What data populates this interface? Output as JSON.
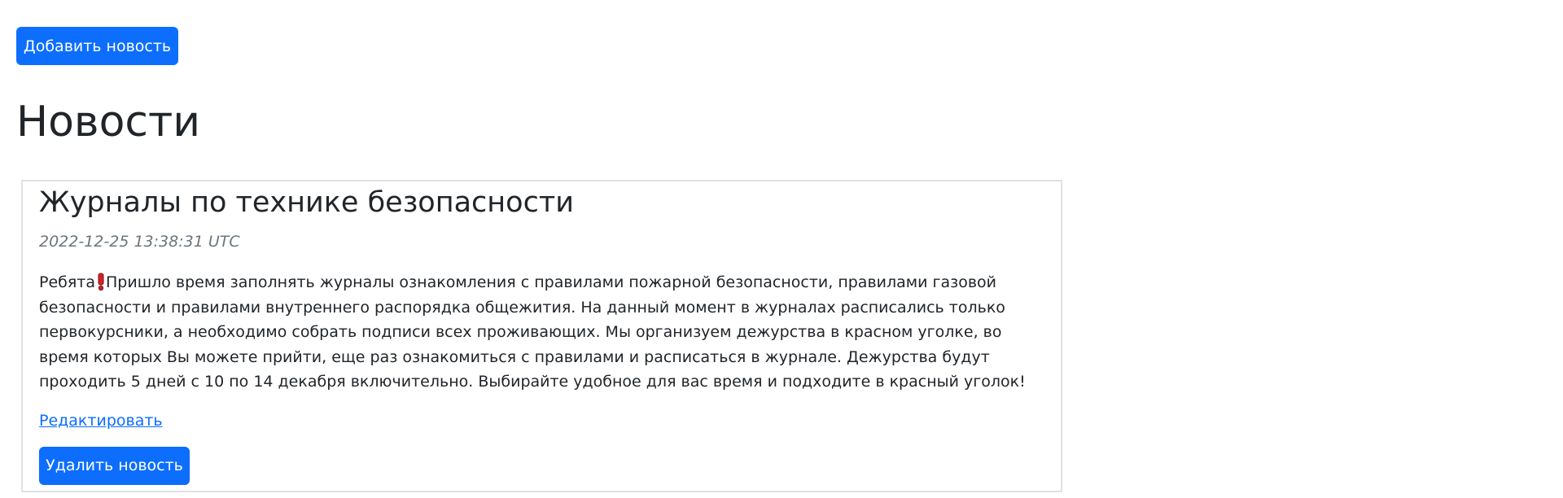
{
  "toolbar": {
    "add_news_label": "Добавить новость"
  },
  "page": {
    "title": "Новости"
  },
  "news": [
    {
      "title": "Журналы по технике безопасности",
      "date": "2022-12-25 13:38:31 UTC",
      "body_prefix": "Ребята",
      "emoji_icon": "exclamation-icon",
      "body": "Пришло время заполнять журналы ознакомления с правилами пожарной безопасности, правилами газовой безопасности и правилами внутреннего распорядка общежития. На данный момент в журналах расписались только первокурсники, а необходимо собрать подписи всех проживающих. Мы организуем дежурства в красном уголке, во время которых Вы можете прийти, еще раз ознакомиться с правилами и расписаться в журнале. Дежурства будут проходить 5 дней с 10 по 14 декабря включительно. Выбирайте удобное для вас время и подходите в красный уголок!",
      "edit_label": "Редактировать",
      "delete_label": "Удалить новость"
    }
  ],
  "colors": {
    "primary": "#0d6efd",
    "text": "#212529",
    "muted": "#6c757d",
    "border": "#dee2e6",
    "emoji_red": "#dc1f26"
  }
}
